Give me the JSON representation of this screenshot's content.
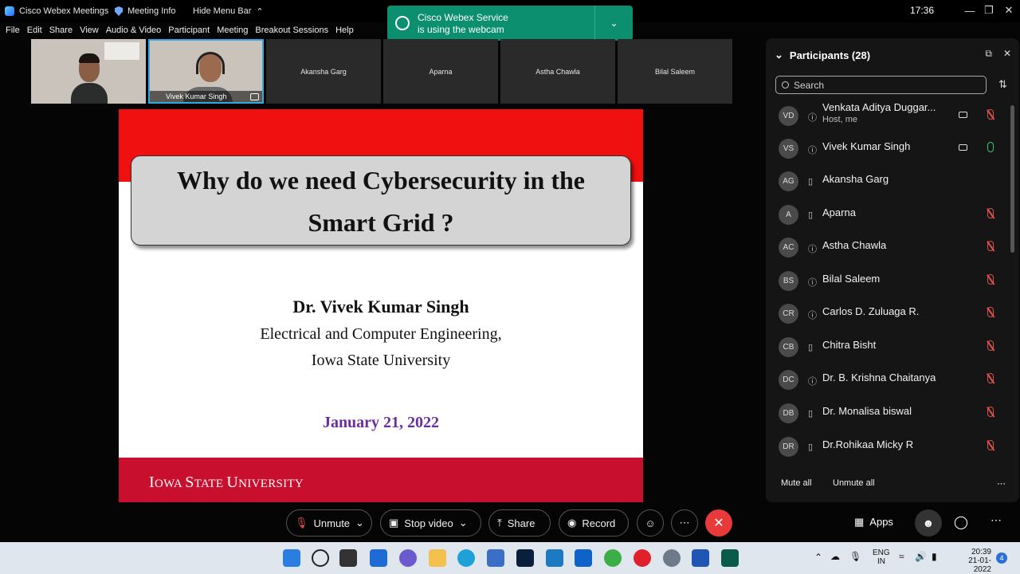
{
  "titlebar": {
    "app_title": "Cisco Webex Meetings",
    "meeting_info": "Meeting Info",
    "hide_menu": "Hide Menu Bar",
    "time": "17:36"
  },
  "menu": [
    "File",
    "Edit",
    "Share",
    "View",
    "Audio & Video",
    "Participant",
    "Meeting",
    "Breakout Sessions",
    "Help"
  ],
  "toast": {
    "line1": "Cisco Webex Service",
    "line2": "is using the webcam"
  },
  "video_strip": {
    "active_speaker": "Vivek Kumar Singh",
    "tiles": [
      "Akansha Garg",
      "Aparna",
      "Astha Chawla",
      "Bilal Saleem"
    ]
  },
  "slide": {
    "title_line1": "Why do we need Cybersecurity in the",
    "title_line2": "Smart Grid ?",
    "author": "Dr. Vivek Kumar Singh",
    "dept": "Electrical and Computer Engineering,",
    "univ": "Iowa State University",
    "date": "January 21, 2022",
    "footer_I": "I",
    "footer_owa": "OWA ",
    "footer_S": "S",
    "footer_tate": "TATE ",
    "footer_U": "U",
    "footer_niversity": "NIVERSITY"
  },
  "participants": {
    "header": "Participants (28)",
    "search_placeholder": "Search",
    "mute_all": "Mute all",
    "unmute_all": "Unmute all",
    "list": [
      {
        "initials": "VD",
        "name": "Venkata Aditya Duggar...",
        "sub": "Host, me"
      },
      {
        "initials": "VS",
        "name": "Vivek Kumar Singh"
      },
      {
        "initials": "AG",
        "name": "Akansha Garg"
      },
      {
        "initials": "A",
        "name": "Aparna"
      },
      {
        "initials": "AC",
        "name": "Astha Chawla"
      },
      {
        "initials": "BS",
        "name": "Bilal Saleem"
      },
      {
        "initials": "CR",
        "name": "Carlos D. Zuluaga R."
      },
      {
        "initials": "CB",
        "name": "Chitra Bisht"
      },
      {
        "initials": "DC",
        "name": "Dr. B. Krishna Chaitanya"
      },
      {
        "initials": "DB",
        "name": "Dr. Monalisa biswal"
      },
      {
        "initials": "DR",
        "name": "Dr.Rohikaa Micky R"
      }
    ]
  },
  "controls": {
    "unmute": "Unmute",
    "stop_video": "Stop video",
    "share": "Share",
    "record": "Record",
    "apps": "Apps"
  },
  "taskbar": {
    "lang1": "ENG",
    "lang2": "IN",
    "time": "20:39",
    "date": "21-01-2022",
    "badge": "4"
  }
}
